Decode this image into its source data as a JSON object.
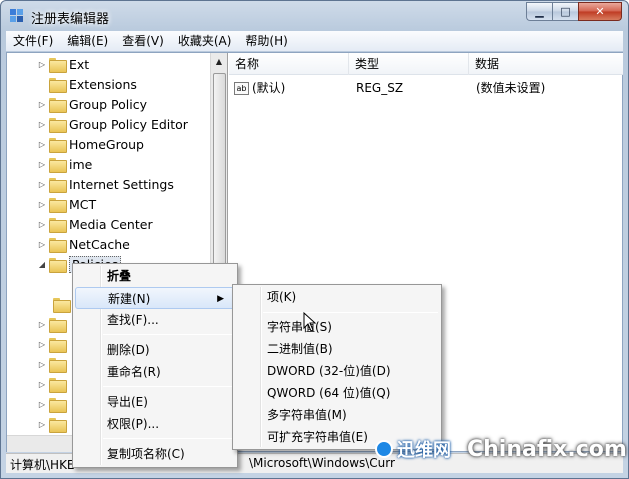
{
  "window": {
    "title": "注册表编辑器"
  },
  "menubar": [
    "文件(F)",
    "编辑(E)",
    "查看(V)",
    "收藏夹(A)",
    "帮助(H)"
  ],
  "tree": {
    "items": [
      {
        "label": "Ext"
      },
      {
        "label": "Extensions"
      },
      {
        "label": "Group Policy"
      },
      {
        "label": "Group Policy Editor"
      },
      {
        "label": "HomeGroup"
      },
      {
        "label": "ime"
      },
      {
        "label": "Internet Settings"
      },
      {
        "label": "MCT"
      },
      {
        "label": "Media Center"
      },
      {
        "label": "NetCache"
      },
      {
        "label": "Policies"
      }
    ]
  },
  "list": {
    "headers": [
      "名称",
      "类型",
      "数据"
    ],
    "rows": [
      {
        "name": "(默认)",
        "type": "REG_SZ",
        "data": "(数值未设置)",
        "icon": "ab-string-icon"
      }
    ]
  },
  "context_menu": {
    "items": [
      "折叠",
      "新建(N)",
      "查找(F)...",
      "删除(D)",
      "重命名(R)",
      "导出(E)",
      "权限(P)...",
      "复制项名称(C)"
    ]
  },
  "submenu": {
    "items": [
      "项(K)",
      "字符串值(S)",
      "二进制值(B)",
      "DWORD (32-位)值(D)",
      "QWORD (64 位)值(Q)",
      "多字符串值(M)",
      "可扩充字符串值(E)"
    ]
  },
  "statusbar": {
    "left": "计算机\\HKE",
    "right": "\\Microsoft\\Windows\\Curr"
  },
  "watermark": {
    "cn": "迅维网",
    "en": "Chinafix.com"
  }
}
